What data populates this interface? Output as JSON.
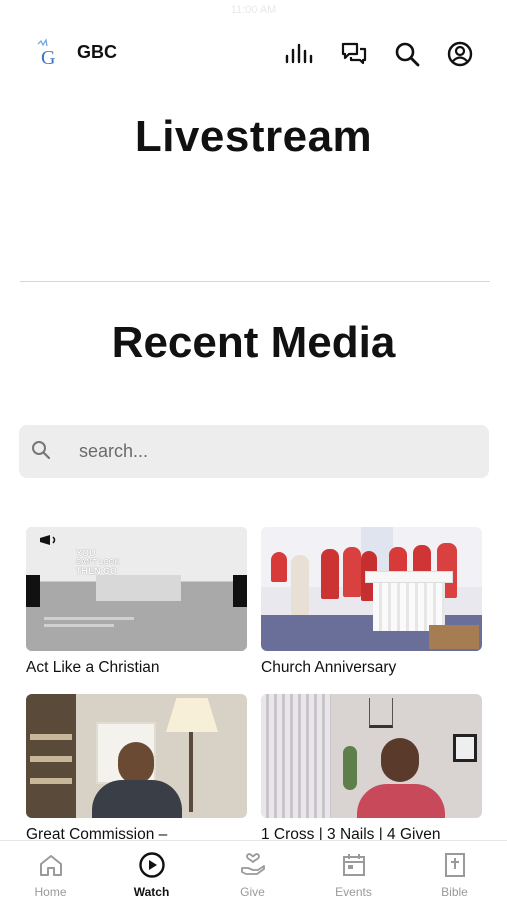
{
  "status_bar": {
    "time": "11:00 AM"
  },
  "header": {
    "brand": "GBC",
    "logo_letter": "G",
    "icons": [
      "bars-icon",
      "chat-icon",
      "search-icon",
      "profile-icon"
    ]
  },
  "page_title": "Livestream",
  "recent_media": {
    "title": "Recent Media",
    "search": {
      "placeholder": "search...",
      "value": ""
    },
    "items": [
      {
        "title": "Act Like a Christian",
        "thumb_text": [
          "YOU",
          "CAN'T LOOK",
          "THEN GO"
        ]
      },
      {
        "title": "Church Anniversary"
      },
      {
        "title": "Great Commission –"
      },
      {
        "title": "1 Cross | 3 Nails | 4 Given"
      }
    ]
  },
  "tabbar": {
    "tabs": [
      {
        "label": "Home",
        "icon": "home-icon",
        "active": false
      },
      {
        "label": "Watch",
        "icon": "play-icon",
        "active": true
      },
      {
        "label": "Give",
        "icon": "give-icon",
        "active": false
      },
      {
        "label": "Events",
        "icon": "calendar-icon",
        "active": false
      },
      {
        "label": "Bible",
        "icon": "bible-icon",
        "active": false
      }
    ]
  },
  "colors": {
    "text": "#111111",
    "inactive": "#9a9a9a",
    "search_bg": "#ededed",
    "logo_blue": "#3b73c4"
  }
}
